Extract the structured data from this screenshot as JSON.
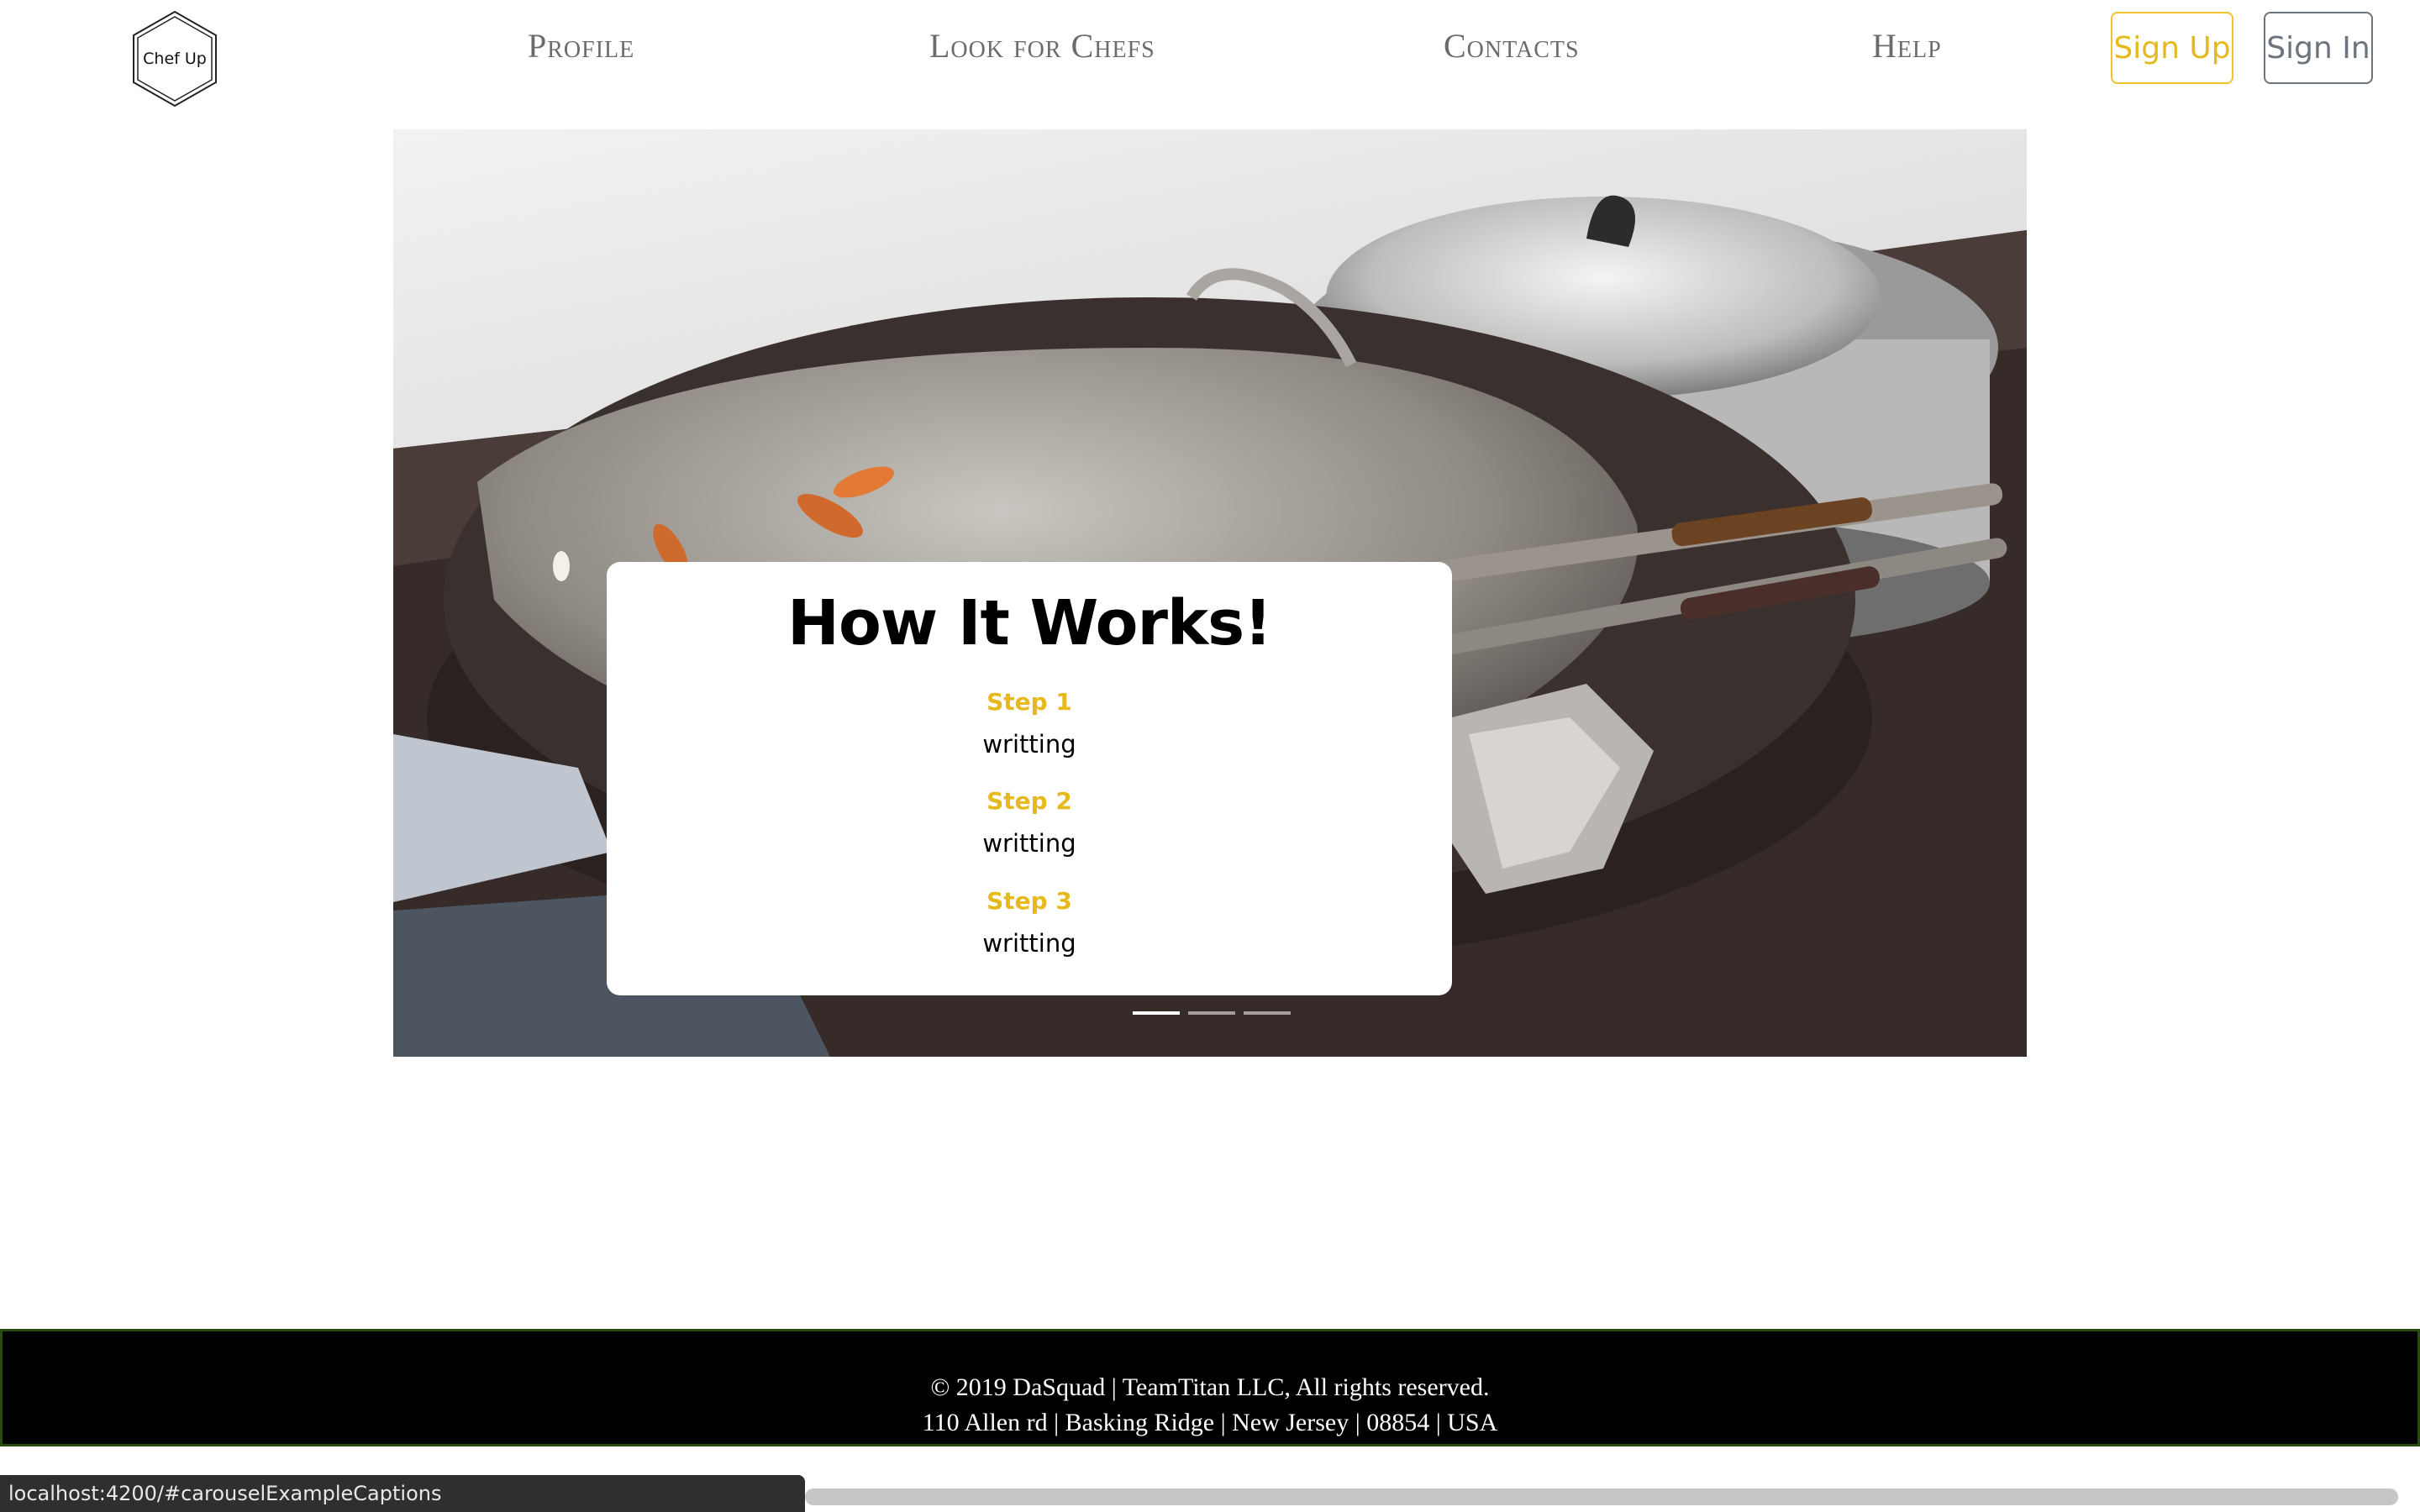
{
  "nav": {
    "logo_text": "Chef Up",
    "links": [
      "Profile",
      "Look for Chefs",
      "Contacts",
      "Help"
    ],
    "sign_up": "Sign Up",
    "sign_in": "Sign In"
  },
  "carousel": {
    "title": "How It Works!",
    "steps": [
      {
        "title": "Step 1",
        "text": "writting"
      },
      {
        "title": "Step 2",
        "text": "writting"
      },
      {
        "title": "Step 3",
        "text": "writting"
      }
    ],
    "active_indicator": 0,
    "indicator_count": 3
  },
  "footer": {
    "line1": "© 2019 DaSquad | TeamTitan LLC, All rights reserved.",
    "line2": "110 Allen rd | Basking Ridge | New Jersey | 08854 | USA"
  },
  "status_bar": {
    "url": "localhost:4200/#carouselExampleCaptions"
  },
  "colors": {
    "accent_yellow": "#e6b91c",
    "secondary_gray": "#6c757d",
    "footer_bg": "#000000"
  }
}
